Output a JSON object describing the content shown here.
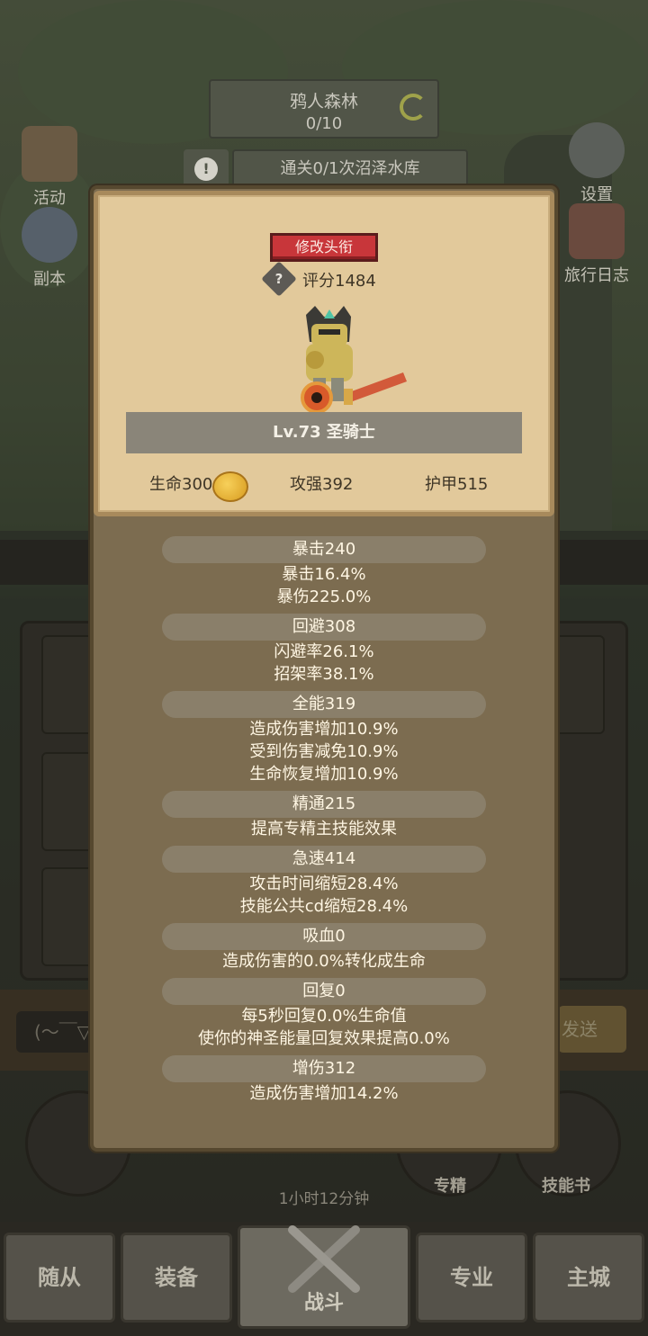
{
  "hud": {
    "zone_name": "鸦人森林",
    "zone_progress": "0/10",
    "quest": "通关0/1次沼泽水库",
    "warning_glyph": "!"
  },
  "side_buttons": {
    "left": [
      "活动",
      "副本"
    ],
    "right": [
      "设置",
      "旅行日志"
    ]
  },
  "chat": {
    "placeholder": "(～￣▽",
    "send_label": "发送"
  },
  "circles": {
    "timer": "1小时12分钟",
    "specialty": "专精",
    "skill_book": "技能书"
  },
  "nav": {
    "tabs": [
      "随从",
      "装备",
      "战斗",
      "专业",
      "主城"
    ],
    "active": "战斗"
  },
  "profile": {
    "edit_title_label": "修改头衔",
    "help_glyph": "?",
    "score": "评分1484",
    "class_label": "Lv.73 圣骑士",
    "hp": "生命300",
    "attack": "攻强392",
    "armor": "护甲515"
  },
  "sections": [
    {
      "header": "暴击240",
      "lines": [
        "暴击16.4%",
        "暴伤225.0%"
      ]
    },
    {
      "header": "回避308",
      "lines": [
        "闪避率26.1%",
        "招架率38.1%"
      ]
    },
    {
      "header": "全能319",
      "lines": [
        "造成伤害增加10.9%",
        "受到伤害减免10.9%",
        "生命恢复增加10.9%"
      ]
    },
    {
      "header": "精通215",
      "lines": [
        "提高专精主技能效果"
      ]
    },
    {
      "header": "急速414",
      "lines": [
        "攻击时间缩短28.4%",
        "技能公共cd缩短28.4%"
      ]
    },
    {
      "header": "吸血0",
      "lines": [
        "造成伤害的0.0%转化成生命"
      ]
    },
    {
      "header": "回复0",
      "lines": [
        "每5秒回复0.0%生命值",
        "使你的神圣能量回复效果提高0.0%"
      ]
    },
    {
      "header": "增伤312",
      "lines": [
        "造成伤害增加14.2%"
      ]
    }
  ],
  "colors": {
    "modal_bg": "#7c6c50",
    "card_bg": "#e2c99b",
    "accent_red": "#c8363a",
    "section_pill": "#8a7f6a"
  }
}
